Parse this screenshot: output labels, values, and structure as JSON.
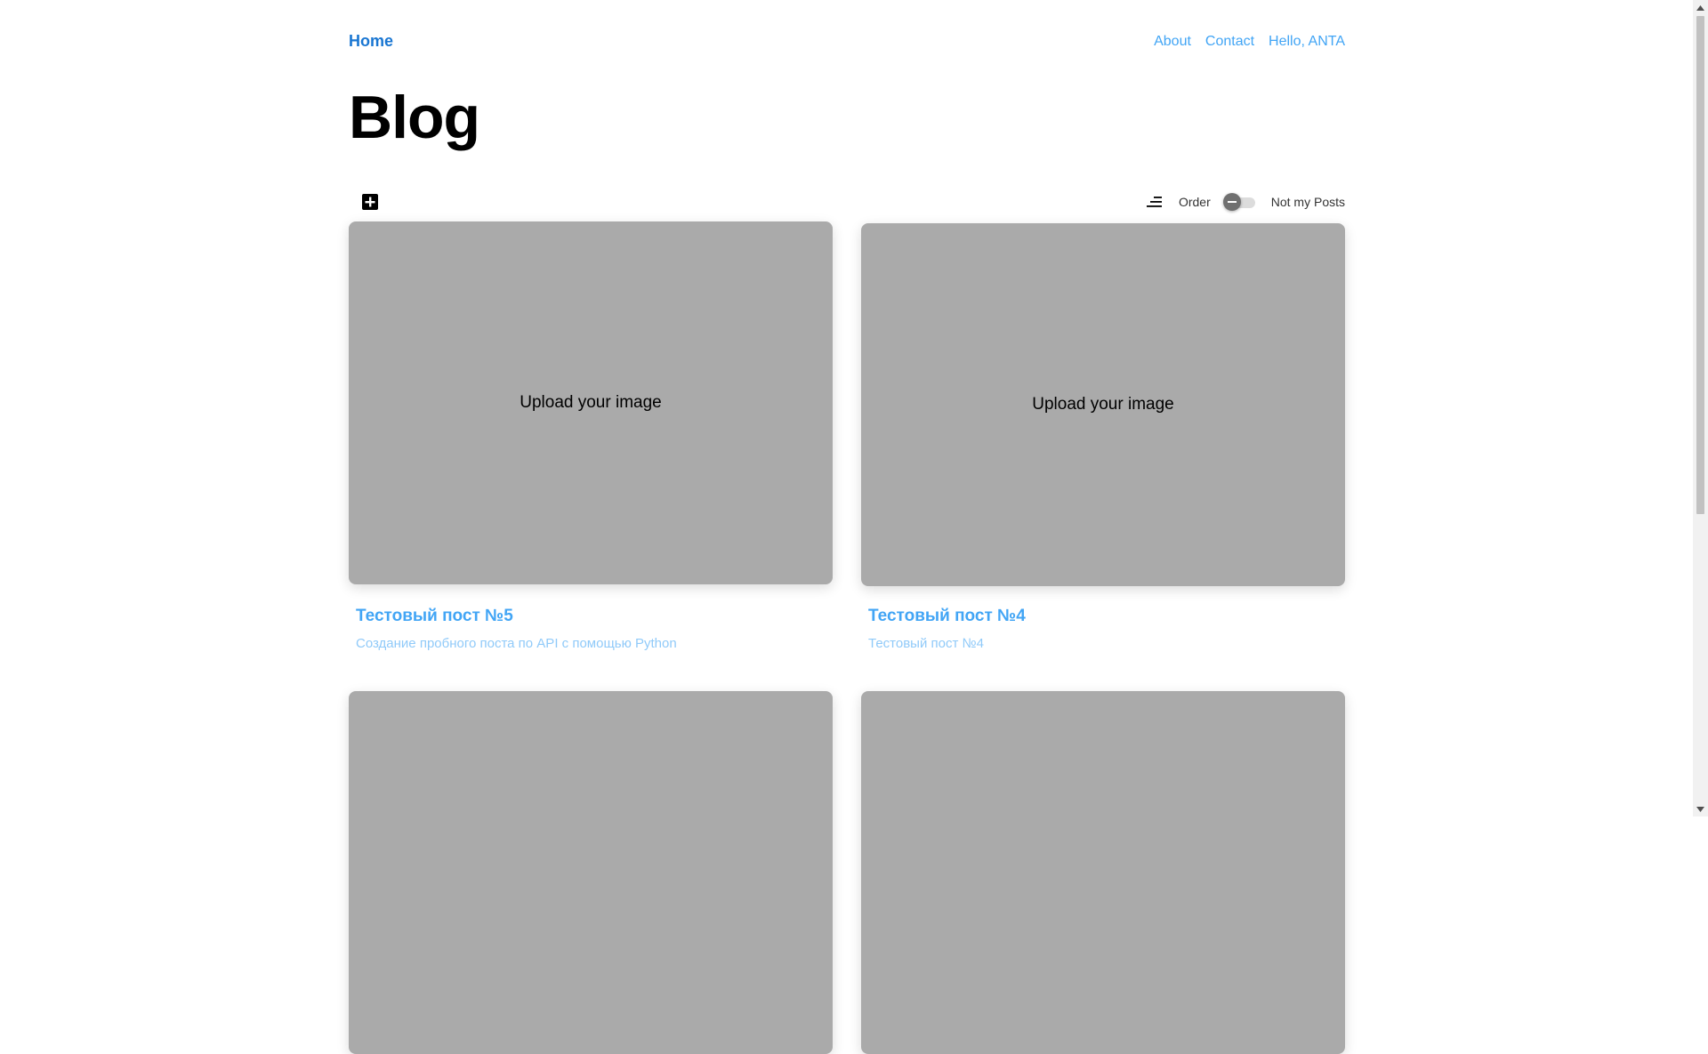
{
  "nav": {
    "home": "Home",
    "links": [
      "About",
      "Contact",
      "Hello, ANTA"
    ]
  },
  "page": {
    "title": "Blog"
  },
  "toolbar": {
    "add_icon": "add-box-icon",
    "sort_icon": "sort-icon",
    "order_label": "Order",
    "filter_label": "Not my Posts",
    "toggle_on": false
  },
  "posts": [
    {
      "image_placeholder": "Upload your image",
      "title": "Тестовый пост №5",
      "description": "Создание пробного поста по API с помощью Python"
    },
    {
      "image_placeholder": "Upload your image",
      "title": "Тестовый пост №4",
      "description": "Тестовый пост №4"
    },
    {
      "image_placeholder": "",
      "title": "",
      "description": ""
    },
    {
      "image_placeholder": "",
      "title": "",
      "description": ""
    }
  ],
  "colors": {
    "brand": "#1976d2",
    "link": "#42a5f5",
    "muted_link": "#90caf9",
    "placeholder_bg": "#aaaaaa"
  }
}
